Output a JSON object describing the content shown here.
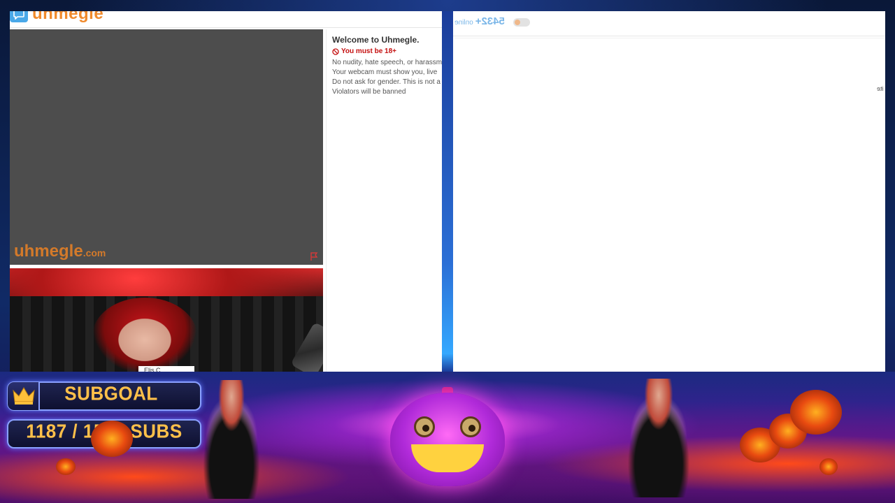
{
  "left_window": {
    "logo_text": "uhmegle",
    "watermark_main": "uhmegle",
    "watermark_suffix": ".com",
    "self_name_tag": "Elis C",
    "welcome": {
      "title": "Welcome to Uhmegle.",
      "age_notice": "You must be 18+",
      "rules": [
        "No nudity, hate speech, or harassment",
        "Your webcam must show you, live",
        "Do not ask for gender. This is not a d",
        "Violators will be banned"
      ]
    }
  },
  "right_window": {
    "online_count": "5432+",
    "online_label": "online",
    "edge_text": "ite"
  },
  "overlay": {
    "subgoal_label": "SUBGOAL",
    "subgoal_progress_text": "1187 / 1500 SUBS",
    "subgoal_current": 1187,
    "subgoal_target": 1500
  },
  "colors": {
    "brand_orange": "#f08a2c",
    "brand_blue": "#4aa8e8",
    "warning_red": "#c40f0f",
    "goal_gold": "#ffc04a"
  },
  "icons": [
    "chat-bubble-icon",
    "report-flag-icon",
    "no-under-18-icon",
    "crown-icon",
    "toggle-switch"
  ]
}
